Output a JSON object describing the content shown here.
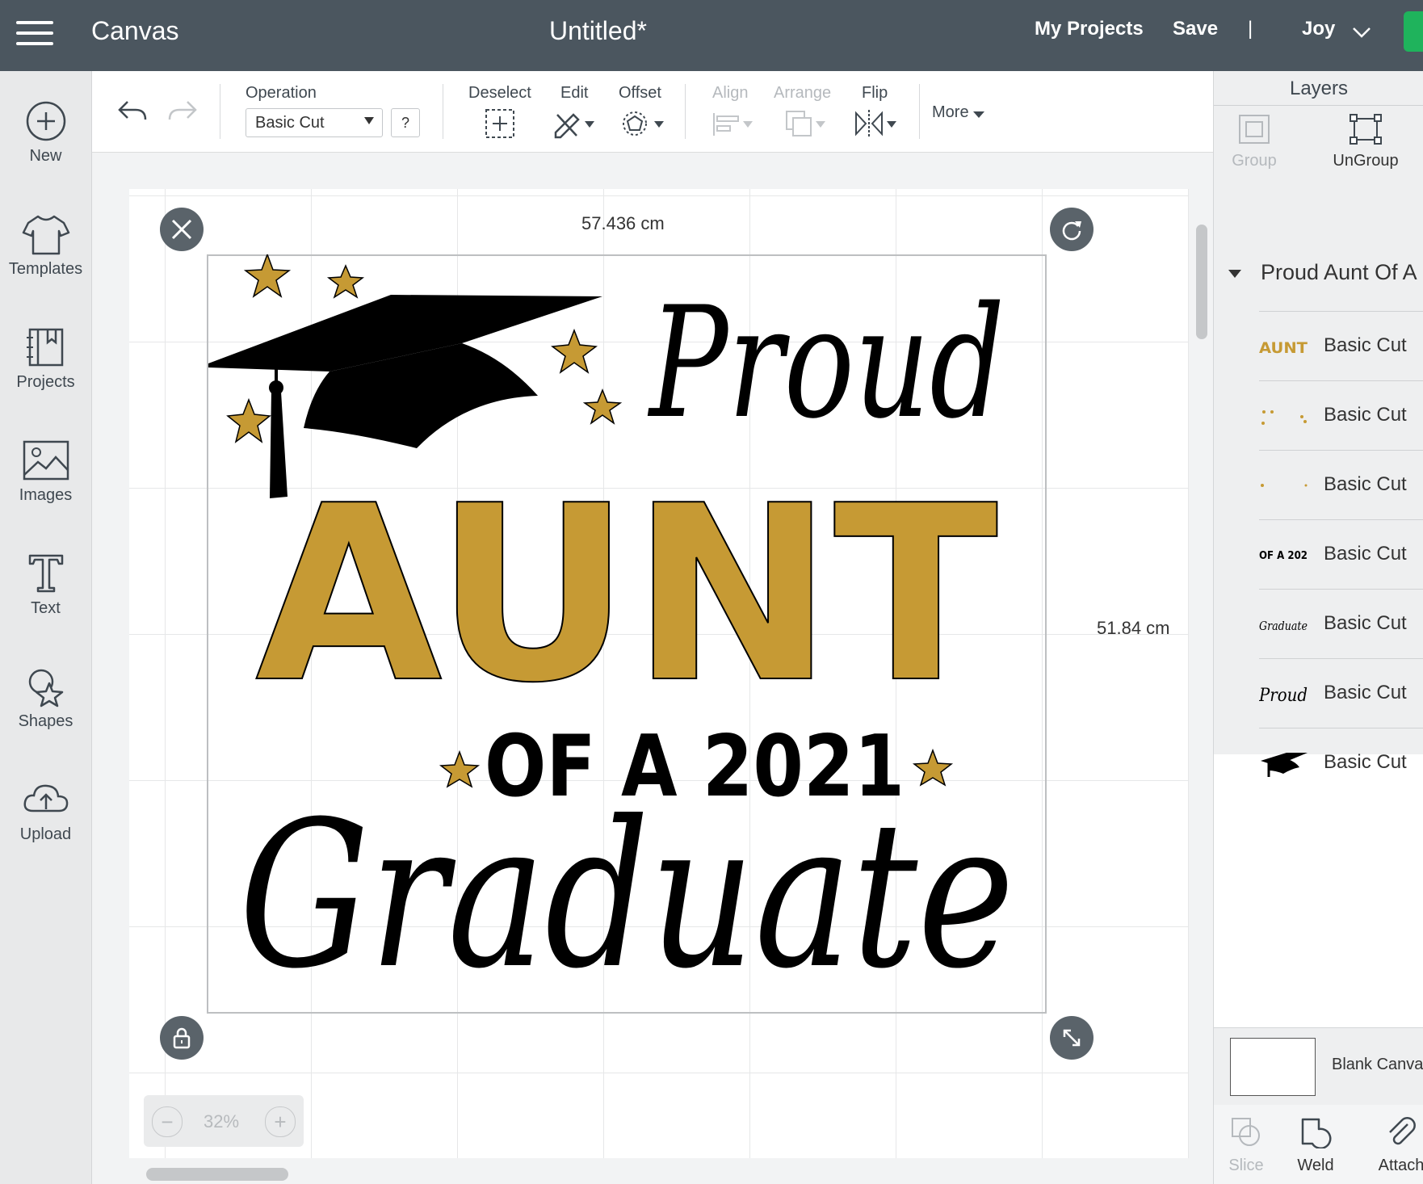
{
  "topbar": {
    "app_name": "Canvas",
    "doc_title": "Untitled*",
    "my_projects": "My Projects",
    "save": "Save",
    "divider": "|",
    "user": "Joy"
  },
  "sidebar": {
    "items": [
      {
        "label": "New",
        "icon": "plus-circle-icon"
      },
      {
        "label": "Templates",
        "icon": "tshirt-icon"
      },
      {
        "label": "Projects",
        "icon": "bookmark-icon"
      },
      {
        "label": "Images",
        "icon": "image-icon"
      },
      {
        "label": "Text",
        "icon": "text-icon"
      },
      {
        "label": "Shapes",
        "icon": "shapes-icon"
      },
      {
        "label": "Upload",
        "icon": "cloud-upload-icon"
      }
    ]
  },
  "toolbar": {
    "operation_label": "Operation",
    "operation_value": "Basic Cut",
    "help": "?",
    "deselect": "Deselect",
    "edit": "Edit",
    "offset": "Offset",
    "align": "Align",
    "arrange": "Arrange",
    "flip": "Flip",
    "more": "More"
  },
  "canvas": {
    "width_dim": "57.436 cm",
    "height_dim": "51.84 cm",
    "zoom": "32%",
    "zoom_minus": "−",
    "zoom_plus": "+"
  },
  "artwork": {
    "line1": "Proud",
    "line2": "AUNT",
    "line3": "OF A 2021",
    "line4": "Graduate",
    "colors": {
      "gold": "#c69a34",
      "black": "#000000"
    }
  },
  "layers": {
    "title": "Layers",
    "group": "Group",
    "ungroup": "UnGroup",
    "group_name": "Proud Aunt Of A",
    "items": [
      {
        "name": "Basic Cut",
        "thumb_text": "AUNT"
      },
      {
        "name": "Basic Cut",
        "thumb_text": ""
      },
      {
        "name": "Basic Cut",
        "thumb_text": ""
      },
      {
        "name": "Basic Cut",
        "thumb_text": "OF A 202"
      },
      {
        "name": "Basic Cut",
        "thumb_text": "Graduate"
      },
      {
        "name": "Basic Cut",
        "thumb_text": "Proud"
      },
      {
        "name": "Basic Cut",
        "thumb_text": ""
      }
    ],
    "blank_canvas": "Blank Canva",
    "slice": "Slice",
    "weld": "Weld",
    "attach": "Attach"
  }
}
